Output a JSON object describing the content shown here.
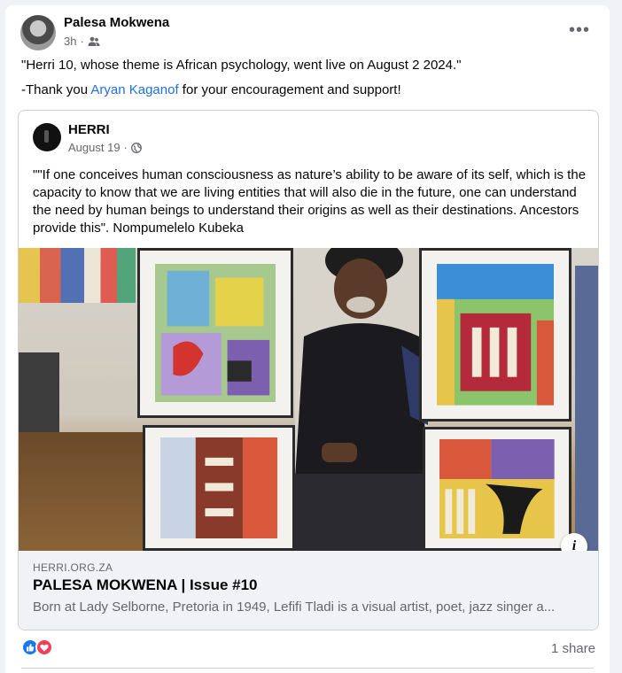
{
  "post": {
    "author": "Palesa Mokwena",
    "time": "3h",
    "separator": "·",
    "audience_icon": "friends-icon",
    "line1": "\"Herri 10, whose theme is African psychology, went live on August 2 2024.\"",
    "line2_prefix": "-Thank you ",
    "line2_link": "Aryan Kaganof",
    "line2_suffix": " for your encouragement and support!"
  },
  "shared": {
    "page_name": "HERRI",
    "date": "August 19",
    "separator": "·",
    "audience_icon": "globe-icon",
    "quote": "\"\"If one conceives human consciousness as nature’s ability to be aware of its self, which is the capacity to know that we are living entities that will also die in the future, one can understand the need by human beings to understand their origins as well as their destinations. Ancestors provide this\". Nompumelelo Kubeka"
  },
  "link_preview": {
    "domain": "HERRI.ORG.ZA",
    "title": "PALESA MOKWENA | Issue #10",
    "description": "Born at Lady Selborne, Pretoria in 1949, Lefifi Tladi is a visual artist, poet, jazz singer a..."
  },
  "footer": {
    "shares": "1 share",
    "reaction_icons": [
      "like-icon",
      "love-icon"
    ]
  },
  "colors": {
    "link": "#216fdb",
    "like": "#1877f2",
    "love": "#f33e58",
    "muted": "#65676b"
  }
}
